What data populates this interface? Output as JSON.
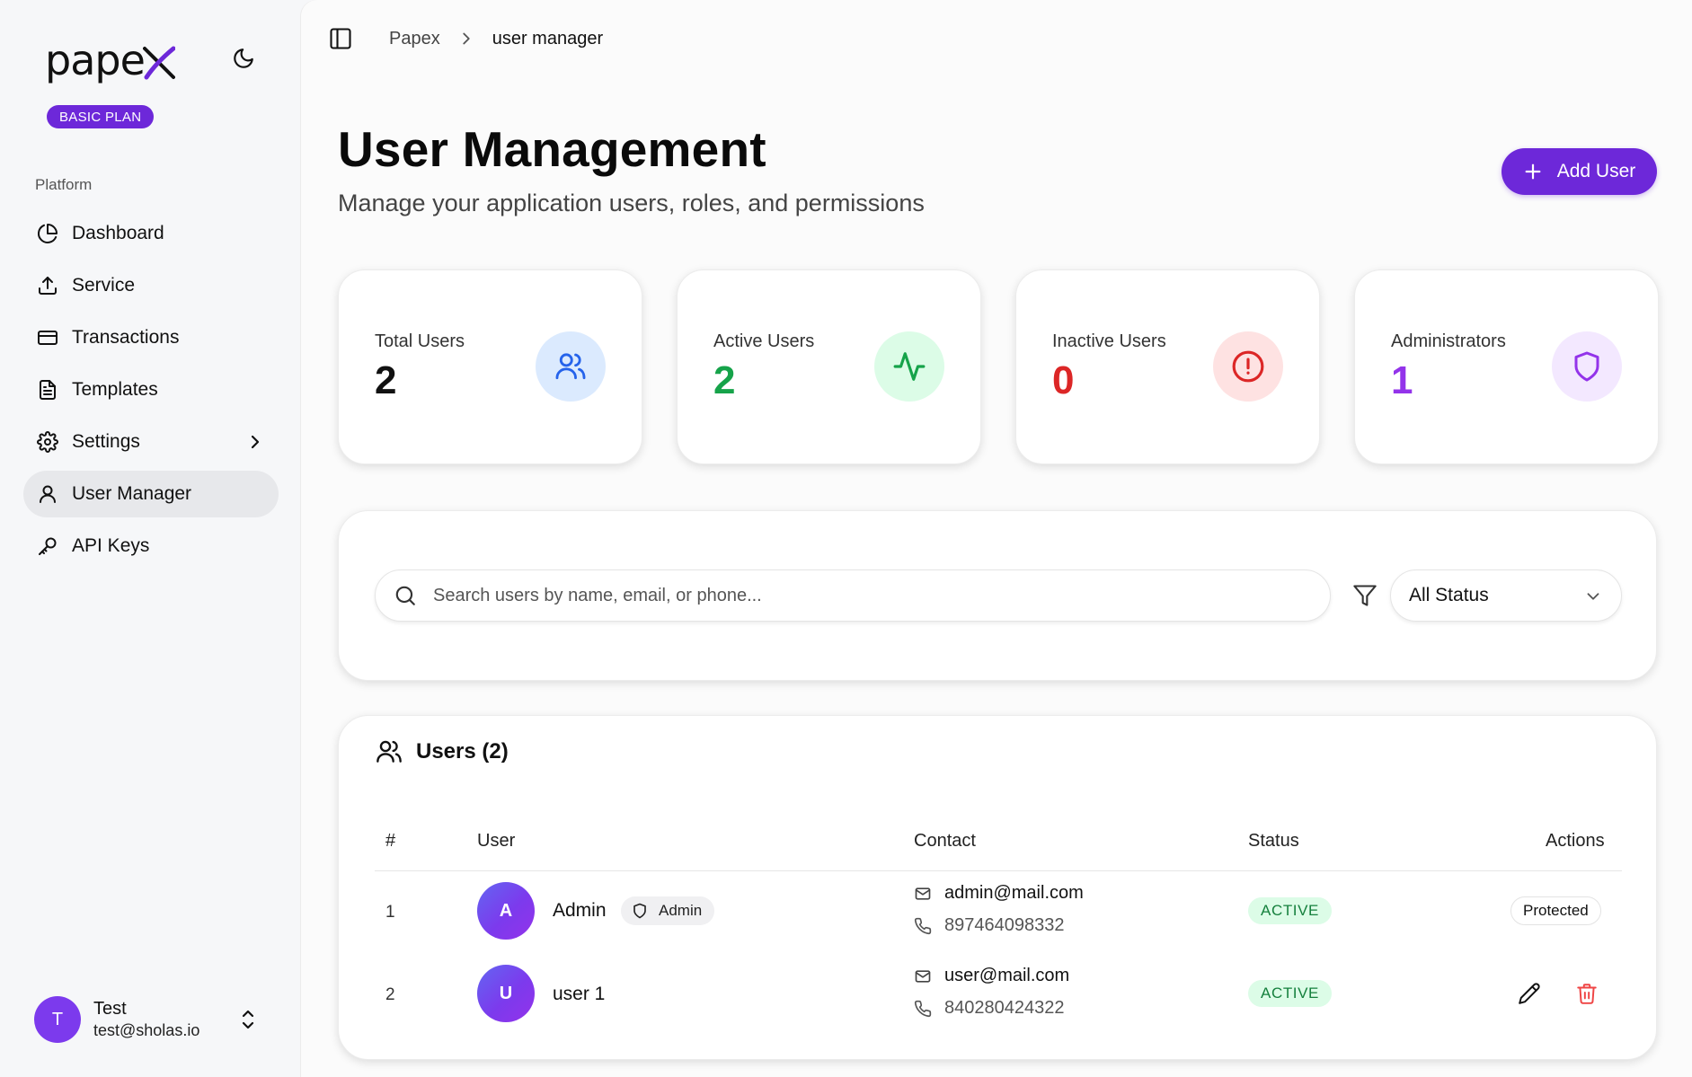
{
  "sidebar": {
    "logo_text": "pape",
    "plan_badge": "BASIC PLAN",
    "section_label": "Platform",
    "items": [
      {
        "label": "Dashboard",
        "icon": "pie-chart-icon"
      },
      {
        "label": "Service",
        "icon": "upload-icon"
      },
      {
        "label": "Transactions",
        "icon": "credit-card-icon"
      },
      {
        "label": "Templates",
        "icon": "file-text-icon"
      },
      {
        "label": "Settings",
        "icon": "gear-icon"
      },
      {
        "label": "User Manager",
        "icon": "user-icon",
        "active": true
      },
      {
        "label": "API Keys",
        "icon": "key-icon"
      }
    ],
    "user": {
      "initial": "T",
      "name": "Test",
      "email": "test@sholas.io"
    }
  },
  "breadcrumb": {
    "root": "Papex",
    "current": "user manager"
  },
  "header": {
    "title": "User Management",
    "subtitle": "Manage your application users, roles, and permissions",
    "add_button": "Add User"
  },
  "stats": [
    {
      "label": "Total Users",
      "value": "2",
      "color": "#111111",
      "icon": "users-icon",
      "icon_bg": "#dbeafe",
      "icon_color": "#2563eb"
    },
    {
      "label": "Active Users",
      "value": "2",
      "color": "#16a34a",
      "icon": "activity-icon",
      "icon_bg": "#dcfce7",
      "icon_color": "#16a34a"
    },
    {
      "label": "Inactive Users",
      "value": "0",
      "color": "#dc2626",
      "icon": "alert-circle-icon",
      "icon_bg": "#fee2e2",
      "icon_color": "#dc2626"
    },
    {
      "label": "Administrators",
      "value": "1",
      "color": "#9333ea",
      "icon": "shield-icon",
      "icon_bg": "#f3e8ff",
      "icon_color": "#9333ea"
    }
  ],
  "filters": {
    "search_placeholder": "Search users by name, email, or phone...",
    "status_value": "All Status"
  },
  "users_table": {
    "title": "Users (2)",
    "columns": [
      "#",
      "User",
      "Contact",
      "Status",
      "Actions"
    ],
    "rows": [
      {
        "num": "1",
        "initial": "A",
        "name": "Admin",
        "role": "Admin",
        "email": "admin@mail.com",
        "phone": "897464098332",
        "status": "ACTIVE",
        "action": "Protected"
      },
      {
        "num": "2",
        "initial": "U",
        "name": "user 1",
        "role": "",
        "email": "user@mail.com",
        "phone": "840280424322",
        "status": "ACTIVE",
        "action": ""
      }
    ]
  },
  "colors": {
    "accent": "#6d28d9",
    "active_nav": "#e7e8eb"
  }
}
